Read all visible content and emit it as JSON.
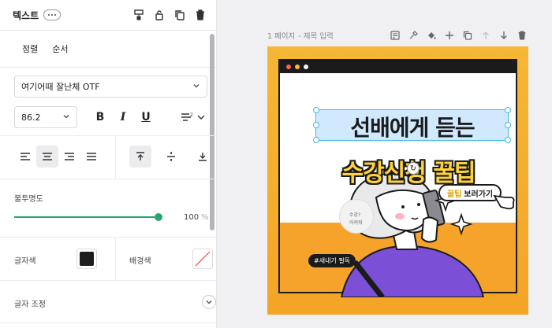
{
  "panel": {
    "title": "텍스트",
    "tabs": [
      "정렬",
      "순서"
    ],
    "font_family": "여기어때 잘난체 OTF",
    "font_size": "86.2",
    "format_bold": "B",
    "format_italic": "I",
    "format_underline": "U",
    "opacity_label": "불투명도",
    "opacity_value": "100",
    "opacity_unit": "%",
    "opacity_level": 1.0,
    "text_color_label": "글자색",
    "text_color": "#1e1e1e",
    "bg_color_label": "배경색",
    "text_adjust_label": "글자 조정"
  },
  "page": {
    "label": "1 페이지",
    "title_placeholder": "- 제목 입력"
  },
  "artboard": {
    "headline_line1": "선배에게 듣는",
    "headline_line2": "수강신청 꿀팁",
    "tip_button_prefix": "꿀팁",
    "tip_button_label": "보러가기",
    "hashtag": "#새내기 필독",
    "bubble_text_1": "수강?",
    "bubble_text_2": "어려워"
  },
  "colors": {
    "accent_green": "#2aa66d",
    "artboard_orange": "#f5a425",
    "headline_yellow": "#ffd23a",
    "selection_blue": "#3fb6e8",
    "shirt_purple": "#7b4fd6"
  }
}
